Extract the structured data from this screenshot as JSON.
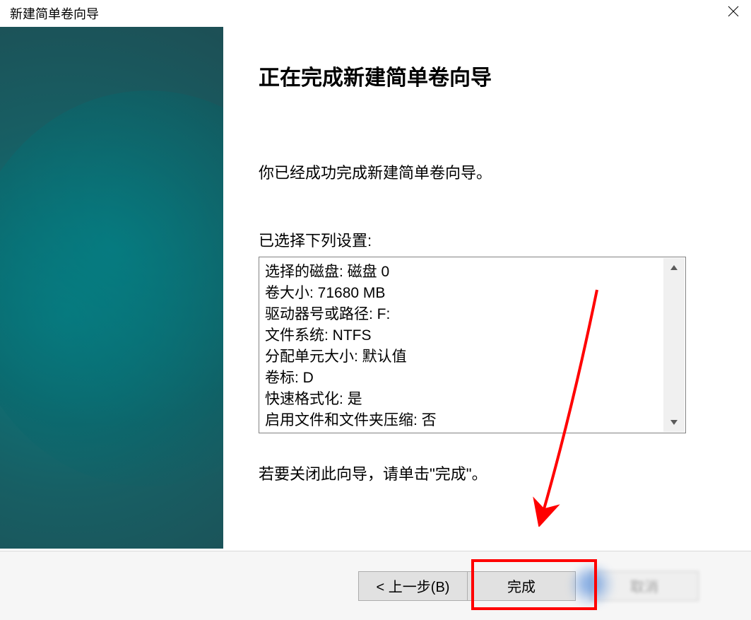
{
  "window": {
    "title": "新建简单卷向导"
  },
  "main": {
    "heading": "正在完成新建简单卷向导",
    "intro": "你已经成功完成新建简单卷向导。",
    "settings_label": "已选择下列设置:",
    "rows": {
      "r0": "选择的磁盘: 磁盘 0",
      "r1": "卷大小: 71680 MB",
      "r2": "驱动器号或路径: F:",
      "r3": "文件系统: NTFS",
      "r4": "分配单元大小: 默认值",
      "r5": "卷标: D",
      "r6": "快速格式化: 是",
      "r7": "启用文件和文件夹压缩: 否"
    },
    "closing": "若要关闭此向导，请单击\"完成\"。"
  },
  "buttons": {
    "back": "< 上一步(B)",
    "finish": "完成",
    "cancel": "取消"
  }
}
